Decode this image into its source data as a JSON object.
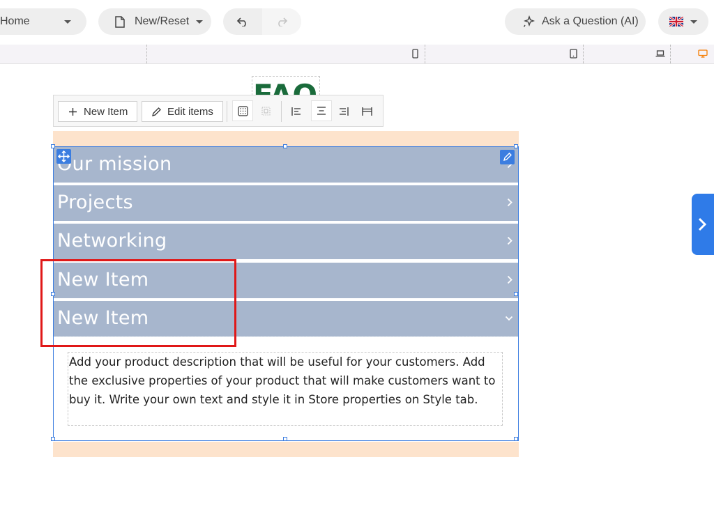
{
  "topbar": {
    "home_label": "Home",
    "new_reset_label": "New/Reset",
    "ask_label": "Ask a Question (AI)",
    "undo_icon": "undo-icon",
    "redo_icon": "redo-icon",
    "language_icon": "uk-flag-icon"
  },
  "ruler": {
    "device_icons": [
      "mobile-icon",
      "tablet-icon",
      "laptop-icon",
      "desktop-icon"
    ],
    "active_device": "desktop",
    "active_color": "#f57c00"
  },
  "page": {
    "heading": "FAQ",
    "heading_color": "#1a6b3b"
  },
  "toolbar": {
    "new_item_label": "New Item",
    "edit_items_label": "Edit items",
    "tools": [
      "grid-icon",
      "ungroup-icon",
      "align-left-icon",
      "align-center-icon",
      "align-right-icon",
      "stretch-icon"
    ]
  },
  "faq": {
    "items": [
      {
        "label": "Our mission",
        "state": "collapsed"
      },
      {
        "label": "Projects",
        "state": "collapsed"
      },
      {
        "label": "Networking",
        "state": "collapsed"
      },
      {
        "label": "New Item",
        "state": "collapsed"
      },
      {
        "label": "New Item",
        "state": "expanded"
      }
    ],
    "description": "Add your product description that will be useful for your customers. Add the exclusive properties of your product that will make customers want to buy it. Write your own text and style it in Store properties on Style tab.",
    "row_color": "#a7b6cd",
    "section_color": "#fde3cc"
  },
  "colors": {
    "accent": "#2f7be8",
    "highlight": "#e01818"
  }
}
